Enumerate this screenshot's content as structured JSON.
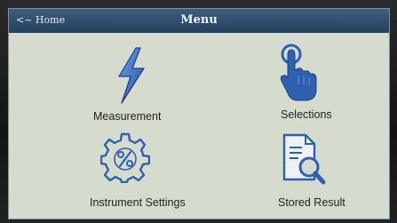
{
  "header": {
    "back_label": "<~ Home",
    "title": "Menu"
  },
  "menu": {
    "items": [
      {
        "label": "Measurement",
        "icon": "lightning-bolt-icon"
      },
      {
        "label": "Selections",
        "icon": "touch-hand-icon"
      },
      {
        "label": "Instrument Settings",
        "icon": "gear-percent-icon"
      },
      {
        "label": "Stored Result",
        "icon": "document-magnifier-icon"
      }
    ]
  },
  "colors": {
    "screen_bg": "#d6dccd",
    "header_bg": "#2e4c6b",
    "icon_blue": "#2f5fb0",
    "icon_outline": "#1e3f85"
  }
}
